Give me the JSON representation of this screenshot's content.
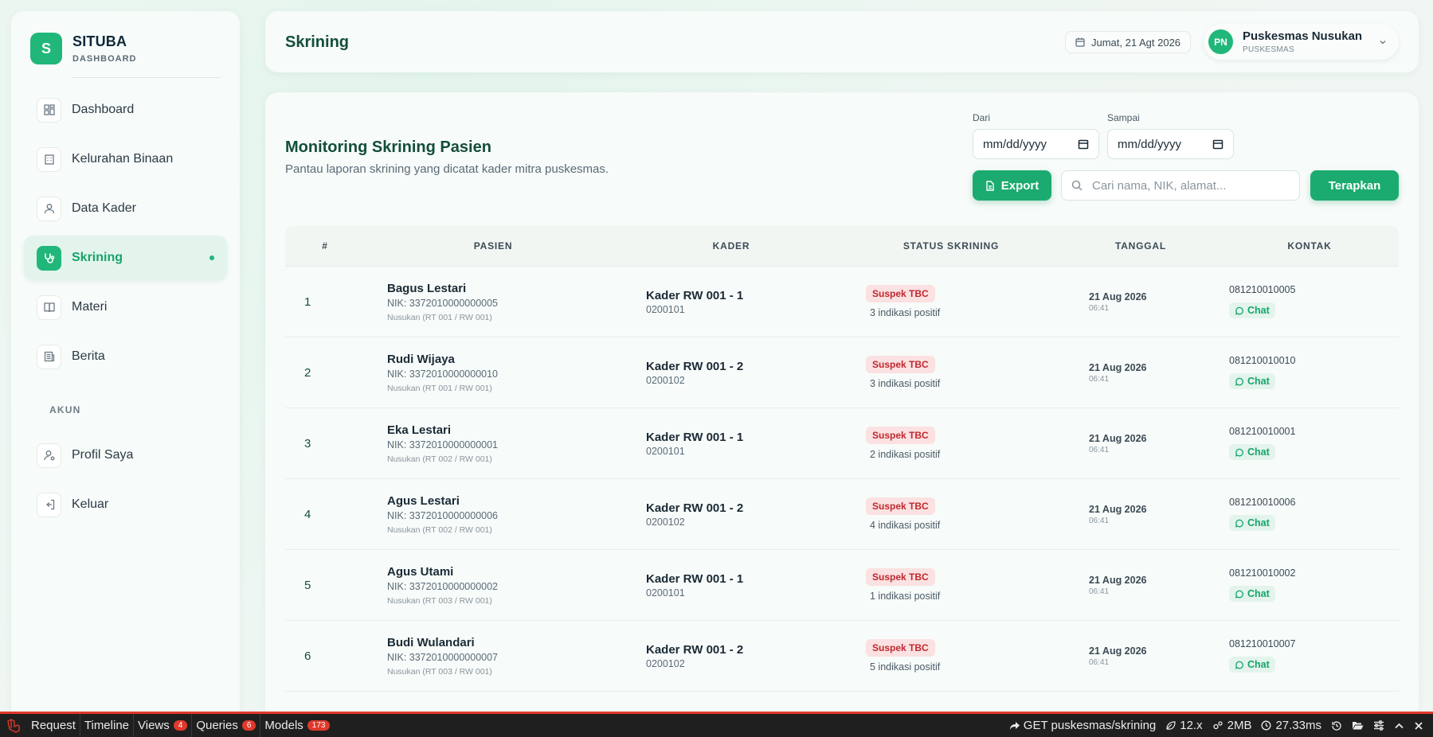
{
  "brand": {
    "logo_letter": "S",
    "name": "SITUBA",
    "subtitle": "DASHBOARD"
  },
  "sidebar": {
    "items": [
      {
        "label": "Dashboard",
        "icon": "dashboard-icon",
        "active": false
      },
      {
        "label": "Kelurahan Binaan",
        "icon": "building-icon",
        "active": false
      },
      {
        "label": "Data Kader",
        "icon": "users-icon",
        "active": false
      },
      {
        "label": "Skrining",
        "icon": "stethoscope-icon",
        "active": true
      },
      {
        "label": "Materi",
        "icon": "book-icon",
        "active": false
      },
      {
        "label": "Berita",
        "icon": "newspaper-icon",
        "active": false
      }
    ],
    "section_label": "AKUN",
    "account_items": [
      {
        "label": "Profil Saya",
        "icon": "user-settings-icon"
      },
      {
        "label": "Keluar",
        "icon": "logout-icon"
      }
    ]
  },
  "header": {
    "title": "Skrining",
    "date": "Jumat, 21 Agt 2026",
    "user": {
      "initials": "PN",
      "name": "Puskesmas Nusukan",
      "role": "PUSKESMAS"
    }
  },
  "main": {
    "title": "Monitoring Skrining Pasien",
    "subtitle": "Pantau laporan skrining yang dicatat kader mitra puskesmas.",
    "filters": {
      "from_label": "Dari",
      "from_value": "mm/dd/yyyy",
      "to_label": "Sampai",
      "to_value": "mm/dd/yyyy",
      "export_label": "Export",
      "search_placeholder": "Cari nama, NIK, alamat...",
      "apply_label": "Terapkan"
    },
    "table": {
      "headers": [
        "#",
        "PASIEN",
        "KADER",
        "STATUS SKRINING",
        "TANGGAL",
        "KONTAK"
      ],
      "rows": [
        {
          "num": "1",
          "name": "Bagus Lestari",
          "nik": "NIK: 3372010000000005",
          "addr": "Nusukan (RT 001 / RW 001)",
          "kader": "Kader RW 001 - 1",
          "kader_code": "0200101",
          "status": "Suspek TBC",
          "indikasi": "3 indikasi positif",
          "date": "21 Aug 2026",
          "time": "06:41",
          "phone": "081210010005",
          "chat": "Chat"
        },
        {
          "num": "2",
          "name": "Rudi Wijaya",
          "nik": "NIK: 3372010000000010",
          "addr": "Nusukan (RT 001 / RW 001)",
          "kader": "Kader RW 001 - 2",
          "kader_code": "0200102",
          "status": "Suspek TBC",
          "indikasi": "3 indikasi positif",
          "date": "21 Aug 2026",
          "time": "06:41",
          "phone": "081210010010",
          "chat": "Chat"
        },
        {
          "num": "3",
          "name": "Eka Lestari",
          "nik": "NIK: 3372010000000001",
          "addr": "Nusukan (RT 002 / RW 001)",
          "kader": "Kader RW 001 - 1",
          "kader_code": "0200101",
          "status": "Suspek TBC",
          "indikasi": "2 indikasi positif",
          "date": "21 Aug 2026",
          "time": "06:41",
          "phone": "081210010001",
          "chat": "Chat"
        },
        {
          "num": "4",
          "name": "Agus Lestari",
          "nik": "NIK: 3372010000000006",
          "addr": "Nusukan (RT 002 / RW 001)",
          "kader": "Kader RW 001 - 2",
          "kader_code": "0200102",
          "status": "Suspek TBC",
          "indikasi": "4 indikasi positif",
          "date": "21 Aug 2026",
          "time": "06:41",
          "phone": "081210010006",
          "chat": "Chat"
        },
        {
          "num": "5",
          "name": "Agus Utami",
          "nik": "NIK: 3372010000000002",
          "addr": "Nusukan (RT 003 / RW 001)",
          "kader": "Kader RW 001 - 1",
          "kader_code": "0200101",
          "status": "Suspek TBC",
          "indikasi": "1 indikasi positif",
          "date": "21 Aug 2026",
          "time": "06:41",
          "phone": "081210010002",
          "chat": "Chat"
        },
        {
          "num": "6",
          "name": "Budi Wulandari",
          "nik": "NIK: 3372010000000007",
          "addr": "Nusukan (RT 003 / RW 001)",
          "kader": "Kader RW 001 - 2",
          "kader_code": "0200102",
          "status": "Suspek TBC",
          "indikasi": "5 indikasi positif",
          "date": "21 Aug 2026",
          "time": "06:41",
          "phone": "081210010007",
          "chat": "Chat"
        }
      ]
    }
  },
  "debugbar": {
    "tabs": [
      {
        "label": "Request"
      },
      {
        "label": "Timeline"
      },
      {
        "label": "Views",
        "count": "4"
      },
      {
        "label": "Queries",
        "count": "6"
      },
      {
        "label": "Models",
        "count": "173"
      }
    ],
    "route": "GET puskesmas/skrining",
    "php_version": "12.x",
    "memory": "2MB",
    "duration": "27.33ms"
  },
  "colors": {
    "accent": "#21b77a",
    "danger": "#c0282f",
    "title": "#134e3a"
  }
}
